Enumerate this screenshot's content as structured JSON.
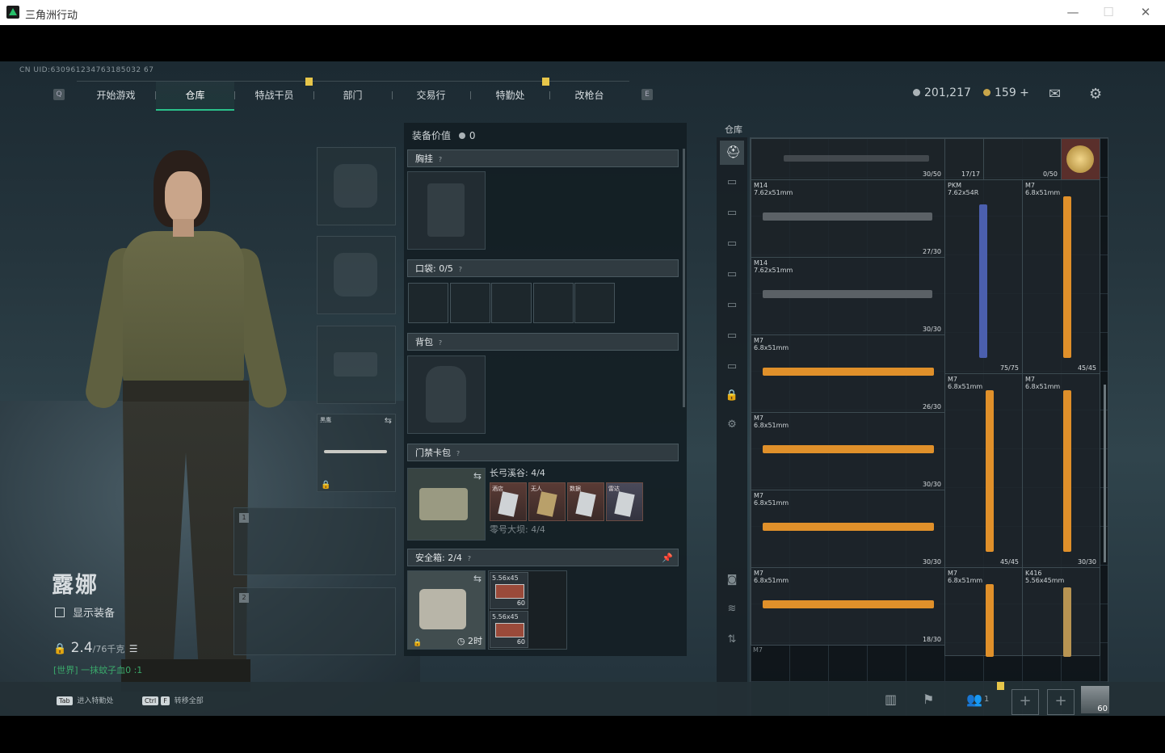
{
  "window": {
    "title": "三角洲行动"
  },
  "uid": "CN UID:630961234763185032 67",
  "nav": {
    "key_left": "Q",
    "key_right": "E",
    "tabs": [
      "开始游戏",
      "仓库",
      "特战干员",
      "部门",
      "交易行",
      "特勤处",
      "改枪台"
    ],
    "active_index": 1
  },
  "currency": {
    "coins": "201,217",
    "premium": "159 +"
  },
  "character": {
    "name": "露娜",
    "show_equipment": "显示装备",
    "weight": "2.4",
    "weight_max": "/76千克",
    "chat": "[世界] 一抹蚊子血0 :1"
  },
  "slots": {
    "melee_label": "黑鹰",
    "weapon1": "1",
    "weapon2": "2"
  },
  "equipment": {
    "value_label": "装备价值",
    "value": "0",
    "chest_label": "胸挂",
    "pocket_label": "口袋:",
    "pocket_count": "0/5",
    "backpack_label": "背包",
    "keycard_label": "门禁卡包",
    "keycard_zone1": "长弓溪谷: 4/4",
    "keycard_zone2": "零号大坝: 4/4",
    "cards": [
      "酒店",
      "无人",
      "数据",
      "雷达"
    ],
    "safebox_label": "安全箱:",
    "safebox_count": "2/4",
    "safebox_timer": "2时",
    "ammo": [
      {
        "name": "5.56x45",
        "count": "60"
      },
      {
        "name": "5.56x45",
        "count": "60"
      }
    ]
  },
  "warehouse": {
    "title": "仓库",
    "top_row": [
      {
        "count": "30/50"
      },
      {
        "count": "17/17"
      },
      {
        "count": "0/50"
      }
    ],
    "items": [
      {
        "name": "M14",
        "cal": "7.62x51mm",
        "count": "27/30"
      },
      {
        "name": "M14",
        "cal": "7.62x51mm",
        "count": "30/30"
      },
      {
        "name": "PKM",
        "cal": "7.62x54R",
        "count": "75/75"
      },
      {
        "name": "M7",
        "cal": "6.8x51mm",
        "count": "45/45"
      },
      {
        "name": "M7",
        "cal": "6.8x51mm",
        "count": "26/30"
      },
      {
        "name": "M7",
        "cal": "6.8x51mm",
        "count": "30/30"
      },
      {
        "name": "M7",
        "cal": "6.8x51mm",
        "count": "30/30"
      },
      {
        "name": "M7",
        "cal": "6.8x51mm",
        "count": "45/45"
      },
      {
        "name": "M7",
        "cal": "6.8x51mm",
        "count": "30/30"
      },
      {
        "name": "M7",
        "cal": "6.8x51mm",
        "count": "18/30"
      },
      {
        "name": "M7",
        "cal": "6.8x51mm",
        "count": ""
      },
      {
        "name": "K416",
        "cal": "5.56x45mm",
        "count": ""
      }
    ],
    "partial_label": "M7"
  },
  "bottom": {
    "hint1_key": "Tab",
    "hint1": "进入特勤处",
    "hint2_key1": "Ctrl",
    "hint2_key2": "F",
    "hint2": "转移全部",
    "squad_count": "1",
    "level": "60"
  },
  "colors": {
    "accent": "#2ac08a",
    "badge": "#e7c64a",
    "gold_gun": "#e0902a"
  }
}
